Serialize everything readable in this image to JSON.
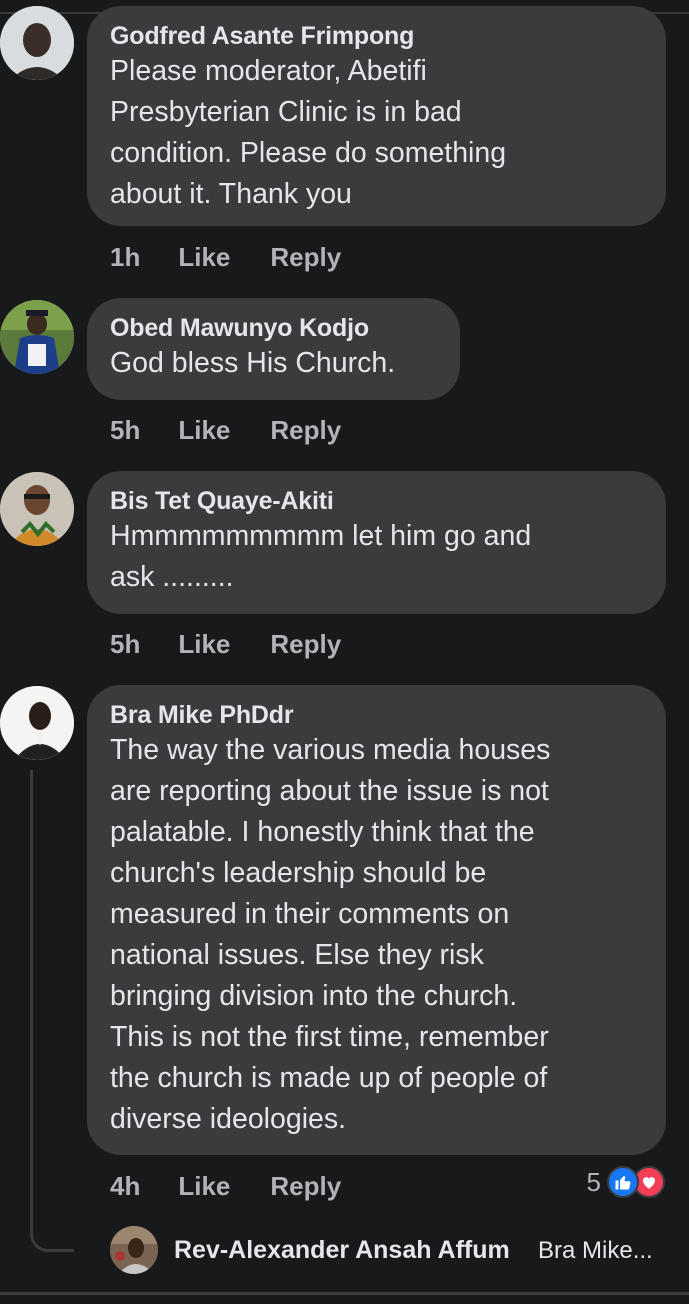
{
  "colors": {
    "background": "#18191a",
    "bubble": "#3a3b3c",
    "primary_text": "#e4e6eb",
    "secondary_text": "#b0b3b8",
    "like_blue": "#1877f2",
    "love_red": "#f33e58"
  },
  "comments": [
    {
      "author": "Godfred Asante Frimpong",
      "lines": [
        "Please moderator, Abetifi",
        "Presbyterian Clinic is in bad",
        "condition. Please do something",
        "about it. Thank you"
      ],
      "time": "1h",
      "like": "Like",
      "reply": "Reply"
    },
    {
      "author": "Obed Mawunyo Kodjo",
      "lines": [
        "God bless His Church."
      ],
      "time": "5h",
      "like": "Like",
      "reply": "Reply"
    },
    {
      "author": "Bis Tet Quaye-Akiti",
      "lines": [
        "Hmmmmmmmmm let him go and",
        "ask ........."
      ],
      "time": "5h",
      "like": "Like",
      "reply": "Reply"
    },
    {
      "author": "Bra Mike PhDdr",
      "lines": [
        "The way the various media houses",
        "are reporting about the issue is not",
        "palatable. I honestly think that the",
        "church's leadership should be",
        "measured in their comments on",
        "national issues. Else they risk",
        "bringing division into the church.",
        "This is not the first time, remember",
        "the church is made up of people of",
        "diverse ideologies."
      ],
      "time": "4h",
      "like": "Like",
      "reply": "Reply",
      "reaction_count": "5",
      "reaction_icons": [
        "thumbs-up-icon",
        "heart-icon"
      ]
    }
  ],
  "reply_preview": {
    "author": "Rev-Alexander Ansah Affum",
    "text": "Bra Mike..."
  }
}
